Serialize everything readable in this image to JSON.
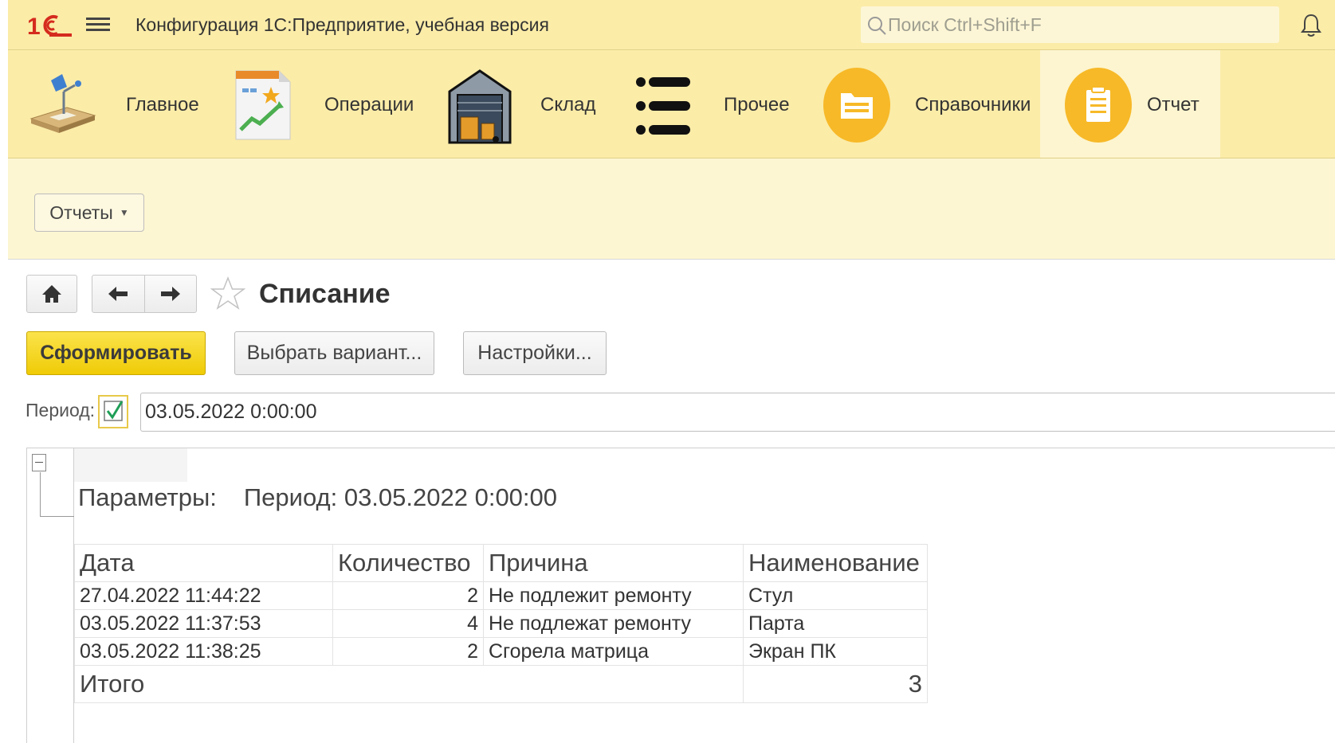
{
  "header": {
    "app_title": "Конфигурация 1С:Предприятие, учебная версия",
    "search_placeholder": "Поиск Ctrl+Shift+F"
  },
  "sections": [
    {
      "label": "Главное",
      "icon": "desk-lamp-icon"
    },
    {
      "label": "Операции",
      "icon": "document-chart-icon"
    },
    {
      "label": "Склад",
      "icon": "warehouse-icon"
    },
    {
      "label": "Прочее",
      "icon": "list-icon"
    },
    {
      "label": "Справочники",
      "icon": "folder-circle-icon"
    },
    {
      "label": "Отчет",
      "icon": "clipboard-circle-icon",
      "active": true
    }
  ],
  "commands": {
    "reports_label": "Отчеты"
  },
  "form": {
    "title": "Списание",
    "generate_label": "Сформировать",
    "choose_variant_label": "Выбрать вариант...",
    "settings_label": "Настройки...",
    "period_label": "Период:",
    "period_checked": true,
    "period_value": "03.05.2022  0:00:00"
  },
  "report": {
    "params_label": "Параметры:",
    "params_value": "Период: 03.05.2022 0:00:00",
    "columns": [
      "Дата",
      "Количество",
      "Причина",
      "Наименование"
    ],
    "rows": [
      [
        "27.04.2022 11:44:22",
        "2",
        "Не подлежит ремонту",
        "Стул"
      ],
      [
        "03.05.2022 11:37:53",
        "4",
        "Не подлежат ремонту",
        "Парта"
      ],
      [
        "03.05.2022 11:38:25",
        "2",
        "Сгорела матрица",
        "Экран ПК"
      ]
    ],
    "total_label": "Итого",
    "total_value": "3"
  },
  "colors": {
    "header_bg": "#fbeca8",
    "panel_bg": "#fdf6d2",
    "primary_button": "#f5d52a",
    "section_icon_orange": "#f7b928"
  }
}
